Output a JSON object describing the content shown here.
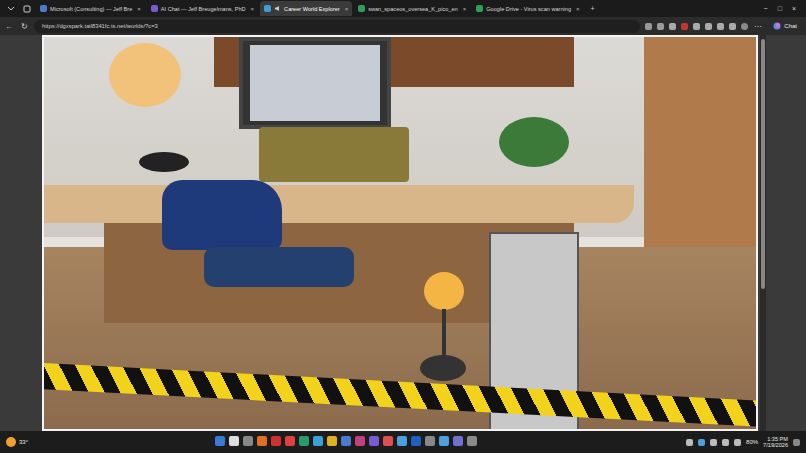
{
  "tabs": [
    {
      "label": "Microsoft (Consulting) — Jeff Bre",
      "selected": false,
      "color": "#4a7bd0"
    },
    {
      "label": "AI Chat — Jeff Breugelmans, PhD",
      "selected": false,
      "color": "#7a5ad0"
    },
    {
      "label": "Career World Explorer",
      "selected": true,
      "color": "#3aa0d8"
    },
    {
      "label": "swan_spaceos_oversea_K_pico_en",
      "selected": false,
      "color": "#2f9e5a"
    },
    {
      "label": "Google Drive - Virus scan warning",
      "selected": false,
      "color": "#2f9e5a"
    }
  ],
  "tab_close": "×",
  "new_tab": "+",
  "window_controls": [
    "−",
    "□",
    "×"
  ],
  "toolbar": {
    "back": "←",
    "reload": "↻",
    "url": "https://dgxspark.tail8341fc.ts.net/worlds/?c=3",
    "chat": "Chat",
    "more": "⋯"
  },
  "taskbar": {
    "weather": "33°",
    "battery": "80%",
    "time": "1:35 PM",
    "date": "7/19/2026"
  }
}
